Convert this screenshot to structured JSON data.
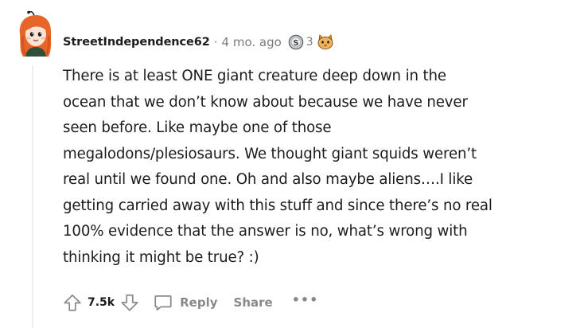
{
  "comment": {
    "author": "StreetIndependence62",
    "separator": "·",
    "age": "4 mo. ago",
    "award_count": "3",
    "body_lines": [
      "There is at least ONE giant creature deep down in the",
      "ocean that we don’t know about because we have never",
      "seen before. Like maybe one of those",
      "megalodons/plesiosaurs. We thought giant squids weren’t",
      "real until we found one. Oh and also maybe aliens….I like",
      "getting carried away with this stuff and since there’s no real",
      "100% evidence that the answer is no, what’s wrong with",
      "thinking it might be true? :)"
    ]
  },
  "actions": {
    "vote_count": "7.5k",
    "reply_label": "Reply",
    "share_label": "Share",
    "more_label": "•••"
  },
  "icons": {
    "avatar": "avatar",
    "award": "silver-award-icon",
    "award2": "cat-award-icon",
    "upvote": "upvote-arrow-icon",
    "downvote": "downvote-arrow-icon",
    "reply": "comment-bubble-icon"
  },
  "colors": {
    "text": "#1c1c1c",
    "meta": "#7c7c7c",
    "action": "#878a8c",
    "thread_line": "#edeff1",
    "avatar_hair": "#e8652a"
  }
}
